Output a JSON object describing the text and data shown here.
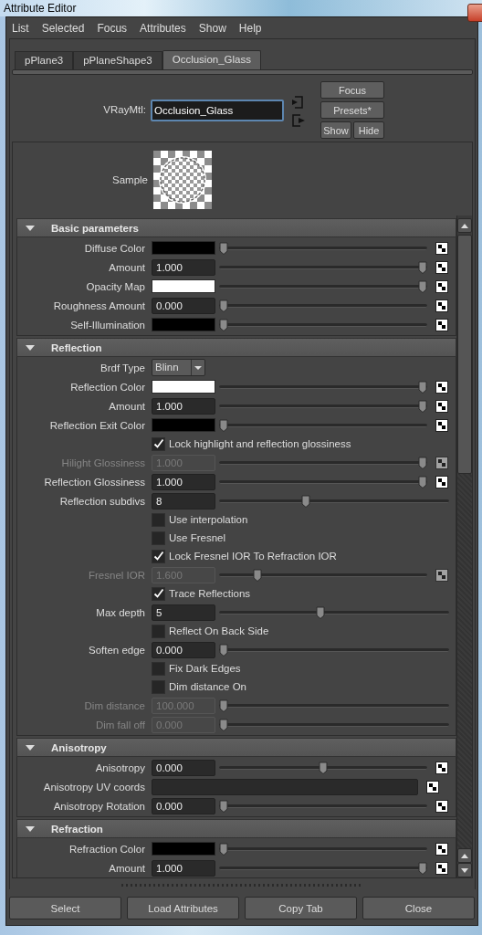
{
  "window": {
    "title": "Attribute Editor"
  },
  "menu": [
    "List",
    "Selected",
    "Focus",
    "Attributes",
    "Show",
    "Help"
  ],
  "tabs": [
    {
      "label": "pPlane3",
      "selected": false
    },
    {
      "label": "pPlaneShape3",
      "selected": false
    },
    {
      "label": "Occlusion_Glass",
      "selected": true
    }
  ],
  "node": {
    "type_label": "VRayMtl:",
    "name": "Occlusion_Glass"
  },
  "node_buttons": [
    "Focus",
    "Presets*"
  ],
  "show_hide": [
    "Show",
    "Hide"
  ],
  "sample": {
    "label": "Sample"
  },
  "sections": [
    {
      "title": "Basic parameters",
      "expanded": true,
      "rows": [
        {
          "kind": "color",
          "label": "Diffuse Color",
          "color": "#000000",
          "level": 0,
          "disabled": false
        },
        {
          "kind": "number",
          "label": "Amount",
          "value": "1.000",
          "level": 1,
          "disabled": false
        },
        {
          "kind": "color",
          "label": "Opacity Map",
          "color": "#ffffff",
          "level": 1,
          "disabled": false
        },
        {
          "kind": "number",
          "label": "Roughness Amount",
          "value": "0.000",
          "level": 0,
          "disabled": false
        },
        {
          "kind": "color",
          "label": "Self-Illumination",
          "color": "#000000",
          "level": 0,
          "disabled": false
        }
      ]
    },
    {
      "title": "Reflection",
      "expanded": true,
      "rows": [
        {
          "kind": "dropdown",
          "label": "Brdf Type",
          "value": "Blinn",
          "disabled": false
        },
        {
          "kind": "color",
          "label": "Reflection Color",
          "color": "#ffffff",
          "level": 1,
          "disabled": false
        },
        {
          "kind": "number",
          "label": "Amount",
          "value": "1.000",
          "level": 1,
          "disabled": false
        },
        {
          "kind": "color",
          "label": "Reflection Exit Color",
          "color": "#000000",
          "level": 0,
          "disabled": false
        },
        {
          "kind": "check",
          "label": "Lock highlight and reflection glossiness",
          "checked": true,
          "disabled": false
        },
        {
          "kind": "number",
          "label": "Hilight Glossiness",
          "value": "1.000",
          "level": 1,
          "disabled": true
        },
        {
          "kind": "number",
          "label": "Reflection Glossiness",
          "value": "1.000",
          "level": 1,
          "disabled": false
        },
        {
          "kind": "plain",
          "label": "Reflection subdivs",
          "value": "8",
          "level": 0.37,
          "disabled": false
        },
        {
          "kind": "check",
          "label": "Use interpolation",
          "checked": false,
          "disabled": false
        },
        {
          "kind": "check",
          "label": "Use Fresnel",
          "checked": false,
          "disabled": false
        },
        {
          "kind": "check",
          "label": "Lock Fresnel IOR To Refraction IOR",
          "checked": true,
          "disabled": false
        },
        {
          "kind": "number",
          "label": "Fresnel IOR",
          "value": "1.600",
          "level": 0.17,
          "disabled": true
        },
        {
          "kind": "check",
          "label": "Trace Reflections",
          "checked": true,
          "disabled": false
        },
        {
          "kind": "plain",
          "label": "Max depth",
          "value": "5",
          "level": 0.44,
          "disabled": false
        },
        {
          "kind": "check",
          "label": "Reflect On Back Side",
          "checked": false,
          "disabled": false
        },
        {
          "kind": "plain",
          "label": "Soften edge",
          "value": "0.000",
          "level": 0,
          "disabled": false
        },
        {
          "kind": "check",
          "label": "Fix Dark Edges",
          "checked": false,
          "disabled": false
        },
        {
          "kind": "check",
          "label": "Dim distance On",
          "checked": false,
          "disabled": false
        },
        {
          "kind": "plain",
          "label": "Dim distance",
          "value": "100.000",
          "level": 0,
          "disabled": true
        },
        {
          "kind": "plain",
          "label": "Dim fall off",
          "value": "0.000",
          "level": 0,
          "disabled": true
        }
      ]
    },
    {
      "title": "Anisotropy",
      "expanded": true,
      "rows": [
        {
          "kind": "number",
          "label": "Anisotropy",
          "value": "0.000",
          "level": 0.5,
          "disabled": false
        },
        {
          "kind": "text",
          "label": "Anisotropy UV coords",
          "disabled": false
        },
        {
          "kind": "number",
          "label": "Anisotropy Rotation",
          "value": "0.000",
          "level": 0,
          "disabled": false
        }
      ]
    },
    {
      "title": "Refraction",
      "expanded": true,
      "rows": [
        {
          "kind": "color",
          "label": "Refraction Color",
          "color": "#000000",
          "level": 0,
          "disabled": false
        },
        {
          "kind": "number",
          "label": "Amount",
          "value": "1.000",
          "level": 1,
          "disabled": false
        }
      ]
    }
  ],
  "bottom_buttons": [
    "Select",
    "Load Attributes",
    "Copy Tab",
    "Close"
  ]
}
